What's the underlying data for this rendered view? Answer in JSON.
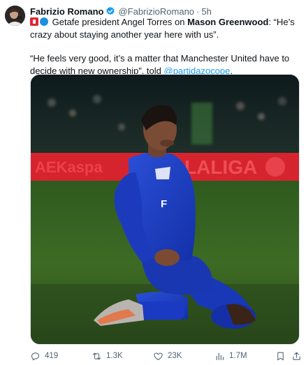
{
  "author": {
    "display_name": "Fabrizio Romano",
    "handle": "@FabrizioRomano",
    "separator": "·",
    "time": "5h",
    "verified_color": "#1d9bf0"
  },
  "tweet": {
    "line1_pre": "Getafe president Angel Torres on ",
    "line1_bold": "Mason Greenwood",
    "line1_post": ": “He’s crazy about staying another year here with us”.",
    "line2_pre": "“He feels very good, it’s a matter that Manchester United have to decide with new ownership”, told ",
    "line2_mention": "@partidazocope",
    "line2_post": ".",
    "emojis": [
      "red-flag-emoji",
      "blue-circle-emoji"
    ]
  },
  "media": {
    "board_text": "LALIGA",
    "board_text_left": "AEKaspa"
  },
  "actions": {
    "replies": "419",
    "retweets": "1.3K",
    "likes": "23K",
    "views": "1.7M",
    "icons": [
      "reply-icon",
      "retweet-icon",
      "like-icon",
      "views-icon",
      "bookmark-icon",
      "share-icon"
    ]
  },
  "colors": {
    "text": "#0f1419",
    "secondary": "#536471",
    "link": "#1d9bf0"
  }
}
